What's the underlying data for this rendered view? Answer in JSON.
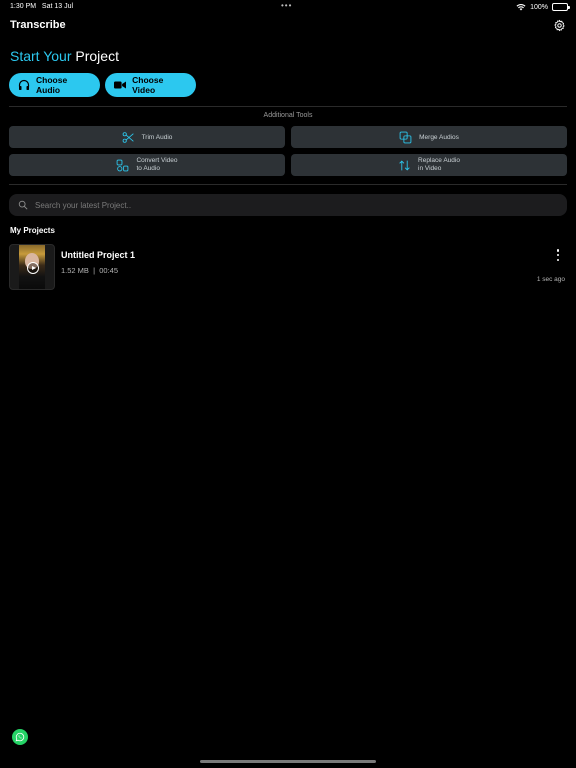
{
  "status_bar": {
    "time": "1:30 PM",
    "date": "Sat 13 Jul",
    "dots": "•••",
    "battery": "100%"
  },
  "nav": {
    "title": "Transcribe"
  },
  "hero": {
    "title_accent": "Start Your",
    "title_rest": "Project"
  },
  "choose": {
    "audio_label": "Choose Audio",
    "video_label": "Choose Video"
  },
  "tools": {
    "label": "Additional Tools",
    "trim": "Trim Audio",
    "merge": "Merge Audios",
    "convert_line1": "Convert Video",
    "convert_line2": "to Audio",
    "replace_line1": "Replace Audio",
    "replace_line2": "in Video"
  },
  "search": {
    "placeholder": "Search your latest Project.."
  },
  "projects": {
    "title": "My Projects",
    "items": [
      {
        "name": "Untitled Project 1",
        "size": "1.52 MB",
        "separator": "|",
        "duration": "00:45",
        "time": "1 sec ago"
      }
    ]
  },
  "colors": {
    "accent": "#2cc8ef",
    "tool_bg": "#2d3236",
    "background": "#000000",
    "whatsapp": "#25d366"
  }
}
